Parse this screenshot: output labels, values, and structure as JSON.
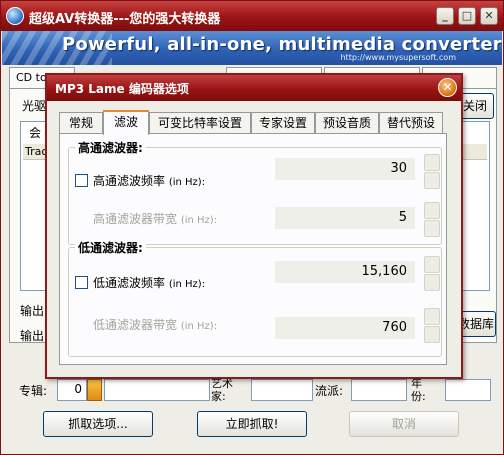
{
  "app": {
    "title": "超级AV转换器---您的强大转换器",
    "banner": "Powerful, all-in-one, multimedia converter!",
    "banner_url": "http://www.mysupersoft.com"
  },
  "main": {
    "tab_cd": "CD to",
    "label_drive": "光驱",
    "btn_close": "关闭",
    "label_convert": "会",
    "label_track": "Trac",
    "label_output1": "输出",
    "label_output2": "输出",
    "label_album": "专辑:",
    "album_value": "0",
    "label_artist": "艺术家:",
    "label_genre": "流派:",
    "label_year": "年份:",
    "btn_database": "数据库",
    "btn_options": "抓取选项...",
    "btn_grab": "立即抓取!",
    "btn_cancel": "取消"
  },
  "dialog": {
    "title": "MP3 Lame 编码器选项",
    "close_glyph": "✕",
    "tabs": [
      "常规",
      "滤波",
      "可变比特率设置",
      "专家设置",
      "预设音质",
      "替代预设"
    ],
    "active_tab": "滤波",
    "highpass": {
      "group_title": "高通滤波器:",
      "freq_label": "高通滤波频率",
      "freq_unit": "(in Hz):",
      "freq_checked": false,
      "freq_value": "30",
      "width_label": "高通滤波器带宽",
      "width_unit": "(in Hz):",
      "width_value": "5"
    },
    "lowpass": {
      "group_title": "低通滤波器:",
      "freq_label": "低通滤波频率",
      "freq_unit": "(in Hz):",
      "freq_checked": false,
      "freq_value": "15,160",
      "width_label": "低通滤波器带宽",
      "width_unit": "(in Hz):",
      "width_value": "760"
    }
  }
}
